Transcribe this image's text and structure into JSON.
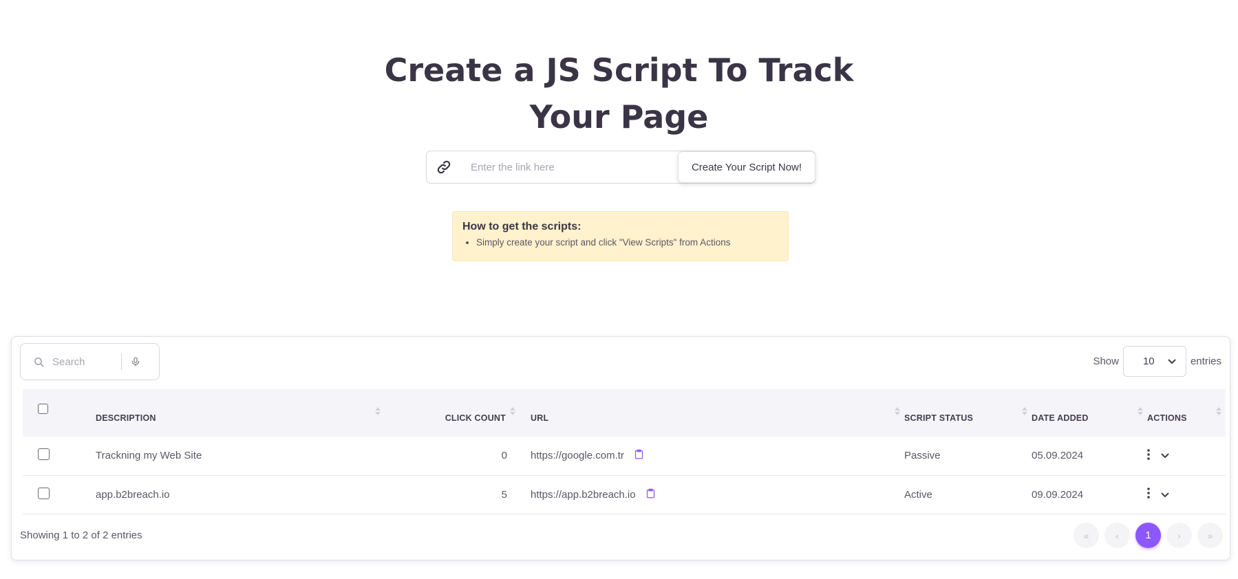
{
  "hero": {
    "title_line1": "Create a JS Script To Track",
    "title_line2": "Your Page"
  },
  "link_form": {
    "icon": "link-icon",
    "placeholder": "Enter the link here",
    "button_label": "Create Your Script Now!"
  },
  "info": {
    "title": "How to get the scripts:",
    "items": [
      "Simply create your script and click \"View Scripts\" from Actions"
    ]
  },
  "table": {
    "search_placeholder": "Search",
    "show_label": "Show",
    "entries_value": "10",
    "entries_label": "entries",
    "columns": [
      "Description",
      "Click Count",
      "URL",
      "Script Status",
      "Date Added",
      "Actions"
    ],
    "rows": [
      {
        "description": "Trackning my Web Site",
        "click_count": "0",
        "url": "https://google.com.tr",
        "status": "Passive",
        "date": "05.09.2024"
      },
      {
        "description": "app.b2breach.io",
        "click_count": "5",
        "url": "https://app.b2breach.io",
        "status": "Active",
        "date": "09.09.2024"
      }
    ],
    "footer_text": "Showing 1 to 2 of 2 entries",
    "pagination": {
      "first": "«",
      "prev": "‹",
      "current": "1",
      "next": "›",
      "last": "»"
    }
  },
  "colors": {
    "accent": "#8c57ff",
    "info_bg": "#fff2cd",
    "header_bg": "#f5f5f9"
  }
}
